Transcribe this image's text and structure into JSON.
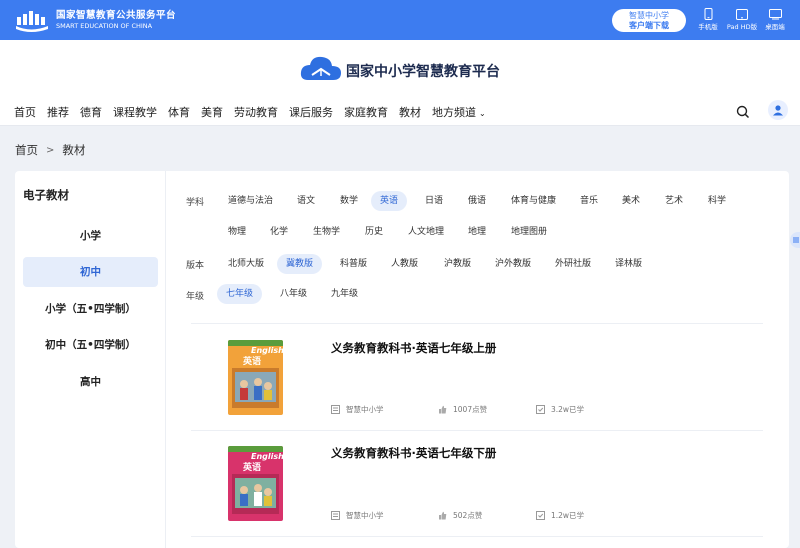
{
  "topbar": {
    "brand_cn": "国家智慧教育公共服务平台",
    "brand_en": "SMART EDUCATION OF CHINA",
    "download_line1": "智慧中小学",
    "download_line2": "客户端下载",
    "devices": [
      {
        "label": "手机版",
        "icon": "phone-icon"
      },
      {
        "label": "Pad HD版",
        "icon": "tablet-icon"
      },
      {
        "label": "桌面端",
        "icon": "desktop-icon"
      }
    ]
  },
  "logo": {
    "title": "国家中小学智慧教育平台"
  },
  "nav": {
    "items": [
      "首页",
      "推荐",
      "德育",
      "课程教学",
      "体育",
      "美育",
      "劳动教育",
      "课后服务",
      "家庭教育",
      "教材",
      "地方频道"
    ]
  },
  "breadcrumb": {
    "home": "首页",
    "sep": ">",
    "current": "教材"
  },
  "sidebar": {
    "title": "电子教材",
    "items": [
      "小学",
      "初中",
      "小学（五•四学制）",
      "初中（五•四学制）",
      "高中"
    ],
    "active_index": 1
  },
  "filters": {
    "subject_label": "学科",
    "subjects_row1": [
      "道德与法治",
      "语文",
      "数学",
      "英语",
      "日语",
      "俄语",
      "体育与健康",
      "音乐",
      "美术",
      "艺术",
      "科学"
    ],
    "subjects_row2": [
      "物理",
      "化学",
      "生物学",
      "历史",
      "人文地理",
      "地理",
      "地理图册"
    ],
    "selected_subject": "英语",
    "version_label": "版本",
    "versions": [
      "北师大版",
      "冀教版",
      "科普版",
      "人教版",
      "沪教版",
      "沪外教版",
      "外研社版",
      "译林版"
    ],
    "selected_version": "冀教版",
    "grade_label": "年级",
    "grades": [
      "七年级",
      "八年级",
      "九年级"
    ],
    "selected_grade": "七年级"
  },
  "books": [
    {
      "title": "义务教育教科书·英语七年级上册",
      "publisher": "智慧中小学",
      "likes": "1007点赞",
      "learners": "3.2w已学",
      "cover_label": "English",
      "cover_cn": "英语",
      "cover_color": "#f2a23a"
    },
    {
      "title": "义务教育教科书·英语七年级下册",
      "publisher": "智慧中小学",
      "likes": "502点赞",
      "learners": "1.2w已学",
      "cover_label": "English",
      "cover_cn": "英语",
      "cover_color": "#d8336b"
    }
  ],
  "colors": {
    "brand_blue": "#3d7cf0",
    "selected_bg": "#e5edfb",
    "selected_text": "#2f66d4",
    "page_bg": "#eef1f6"
  }
}
